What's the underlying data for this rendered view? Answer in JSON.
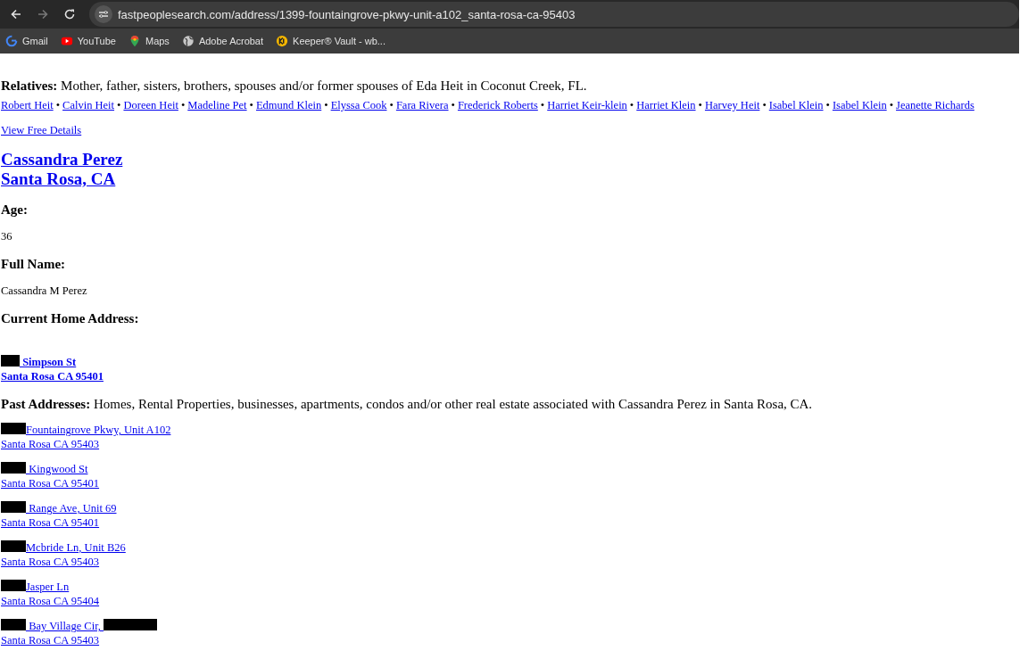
{
  "browser": {
    "nav": [
      {
        "kind": "back",
        "disabled": false
      },
      {
        "kind": "forward",
        "disabled": true
      },
      {
        "kind": "reload",
        "disabled": false
      }
    ],
    "url": "fastpeoplesearch.com/address/1399-fountaingrove-pkwy-unit-a102_santa-rosa-ca-95403",
    "bookmarks": [
      {
        "kind": "google",
        "label": "Gmail"
      },
      {
        "kind": "youtube",
        "label": "YouTube"
      },
      {
        "kind": "maps",
        "label": "Maps"
      },
      {
        "kind": "globe",
        "label": "Adobe Acrobat"
      },
      {
        "kind": "keeper",
        "label": "Keeper® Vault - wb..."
      }
    ]
  },
  "relatives": {
    "label": "Relatives:",
    "text": "Mother, father, sisters, brothers, spouses and/or former spouses of Eda Heit in Coconut Creek, FL.",
    "links": [
      "Robert Heit",
      "Calvin Heit",
      "Doreen Heit",
      "Madeline Pet",
      "Edmund Klein",
      "Elyssa Cook",
      "Fara Rivera",
      "Frederick Roberts",
      "Harriet Keir-klein",
      "Harriet Klein",
      "Harvey Heit",
      "Isabel Klein",
      "Isabel Klein",
      "Jeanette Richards"
    ],
    "separator": "•"
  },
  "details_link": "View Free Details",
  "person": {
    "name": "Cassandra Perez",
    "location": "Santa Rosa, CA",
    "fields": [
      {
        "label": "Age:",
        "value": "36"
      },
      {
        "label": "Full Name:",
        "value": "Cassandra M Perez"
      }
    ],
    "current_label": "Current Home Address:",
    "current_address": {
      "redacted_prefix": true,
      "street": " Simpson St",
      "city": "Santa Rosa CA 95401"
    },
    "past_label": "Past Addresses:",
    "past_text": "Homes, Rental Properties, businesses, apartments, condos and/or other real estate associated with Cassandra Perez in Santa Rosa, CA.",
    "past_addresses": [
      {
        "redacted_prefix": true,
        "redacted_suffix": false,
        "street": "Fountaingrove Pkwy, Unit A102",
        "city": "Santa Rosa CA 95403"
      },
      {
        "redacted_prefix": true,
        "redacted_suffix": false,
        "street": " Kingwood St",
        "city": "Santa Rosa CA 95401"
      },
      {
        "redacted_prefix": true,
        "redacted_suffix": false,
        "street": " Range Ave, Unit 69",
        "city": "Santa Rosa CA 95401"
      },
      {
        "redacted_prefix": true,
        "redacted_suffix": false,
        "street": "Mcbride Ln, Unit B26",
        "city": "Santa Rosa CA 95403"
      },
      {
        "redacted_prefix": true,
        "redacted_suffix": false,
        "street": "Jasper Ln",
        "city": "Santa Rosa CA 95404"
      },
      {
        "redacted_prefix": true,
        "redacted_suffix": true,
        "street": " Bay Village Cir, ",
        "city": "Santa Rosa CA 95403"
      }
    ]
  }
}
